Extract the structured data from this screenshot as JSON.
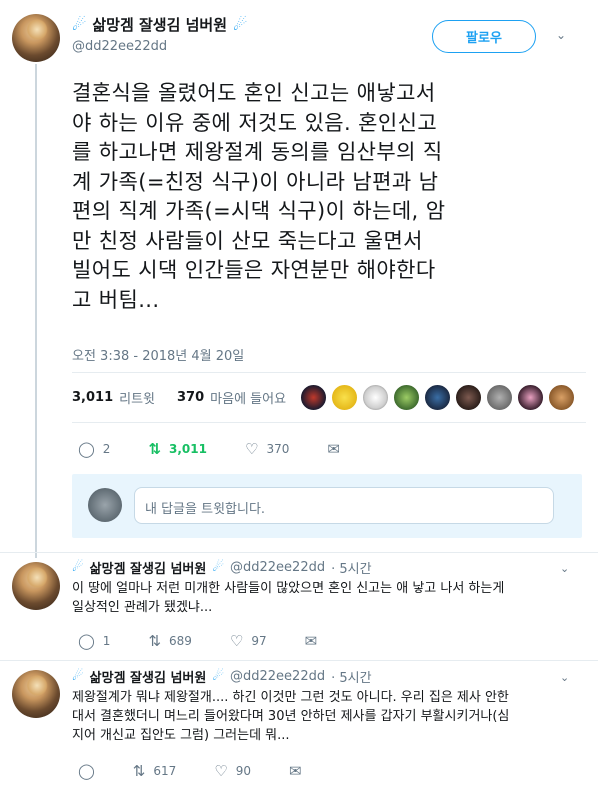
{
  "author": {
    "name": "삶망겜 잘생김 넘버원",
    "handle": "@dd22ee22dd",
    "badge_icon": "feather-icon"
  },
  "follow_label": "팔로우",
  "tweet": {
    "text": "결혼식을 올렸어도 혼인 신고는 애낳고서\n야 하는 이유 중에 저것도 있음. 혼인신고\n를 하고나면 제왕절계 동의를 임산부의 직\n계 가족(=친정 식구)이 아니라 남편과 남\n편의 직계 가족(=시댁 식구)이 하는데, 암\n만 친정 사람들이 산모 죽는다고 울면서\n빌어도 시댁 인간들은 자연분만 해야한다\n고 버팀...",
    "timestamp": "오전 3:38 - 2018년 4월 20일",
    "retweet_count": "3,011",
    "retweet_label": "리트윗",
    "like_count": "370",
    "like_label": "마음에 들어요",
    "actions": {
      "replies": "2",
      "retweets": "3,011",
      "likes": "370"
    }
  },
  "reply_placeholder": "내 답글을 트윗합니다.",
  "replies": [
    {
      "name": "삶망겜 잘생김 넘버원",
      "handle": "@dd22ee22dd",
      "time": "· 5시간",
      "text": "이 땅에 얼마나 저런 미개한 사람들이 많았으면 혼인 신고는 애 낳고 나서 하는게\n일상적인 관례가 됐겠냐...",
      "replies": "1",
      "retweets": "689",
      "likes": "97"
    },
    {
      "name": "삶망겜 잘생김 넘버원",
      "handle": "@dd22ee22dd",
      "time": "· 5시간",
      "text": "제왕절계가 뭐냐 제왕절개.... 하긴 이것만 그런 것도 아니다. 우리 집은 제사 안한\n대서 결혼했더니 며느리 들어왔다며 30년 안하던 제사를 갑자기 부활시키거나(심\n지어 개신교 집안도 그럼) 그러는데 뭐...",
      "replies": "0",
      "retweets": "617",
      "likes": "90"
    }
  ],
  "colors": {
    "accent": "#1da1f2",
    "retweet_active": "#17bf63",
    "muted": "#657786"
  }
}
